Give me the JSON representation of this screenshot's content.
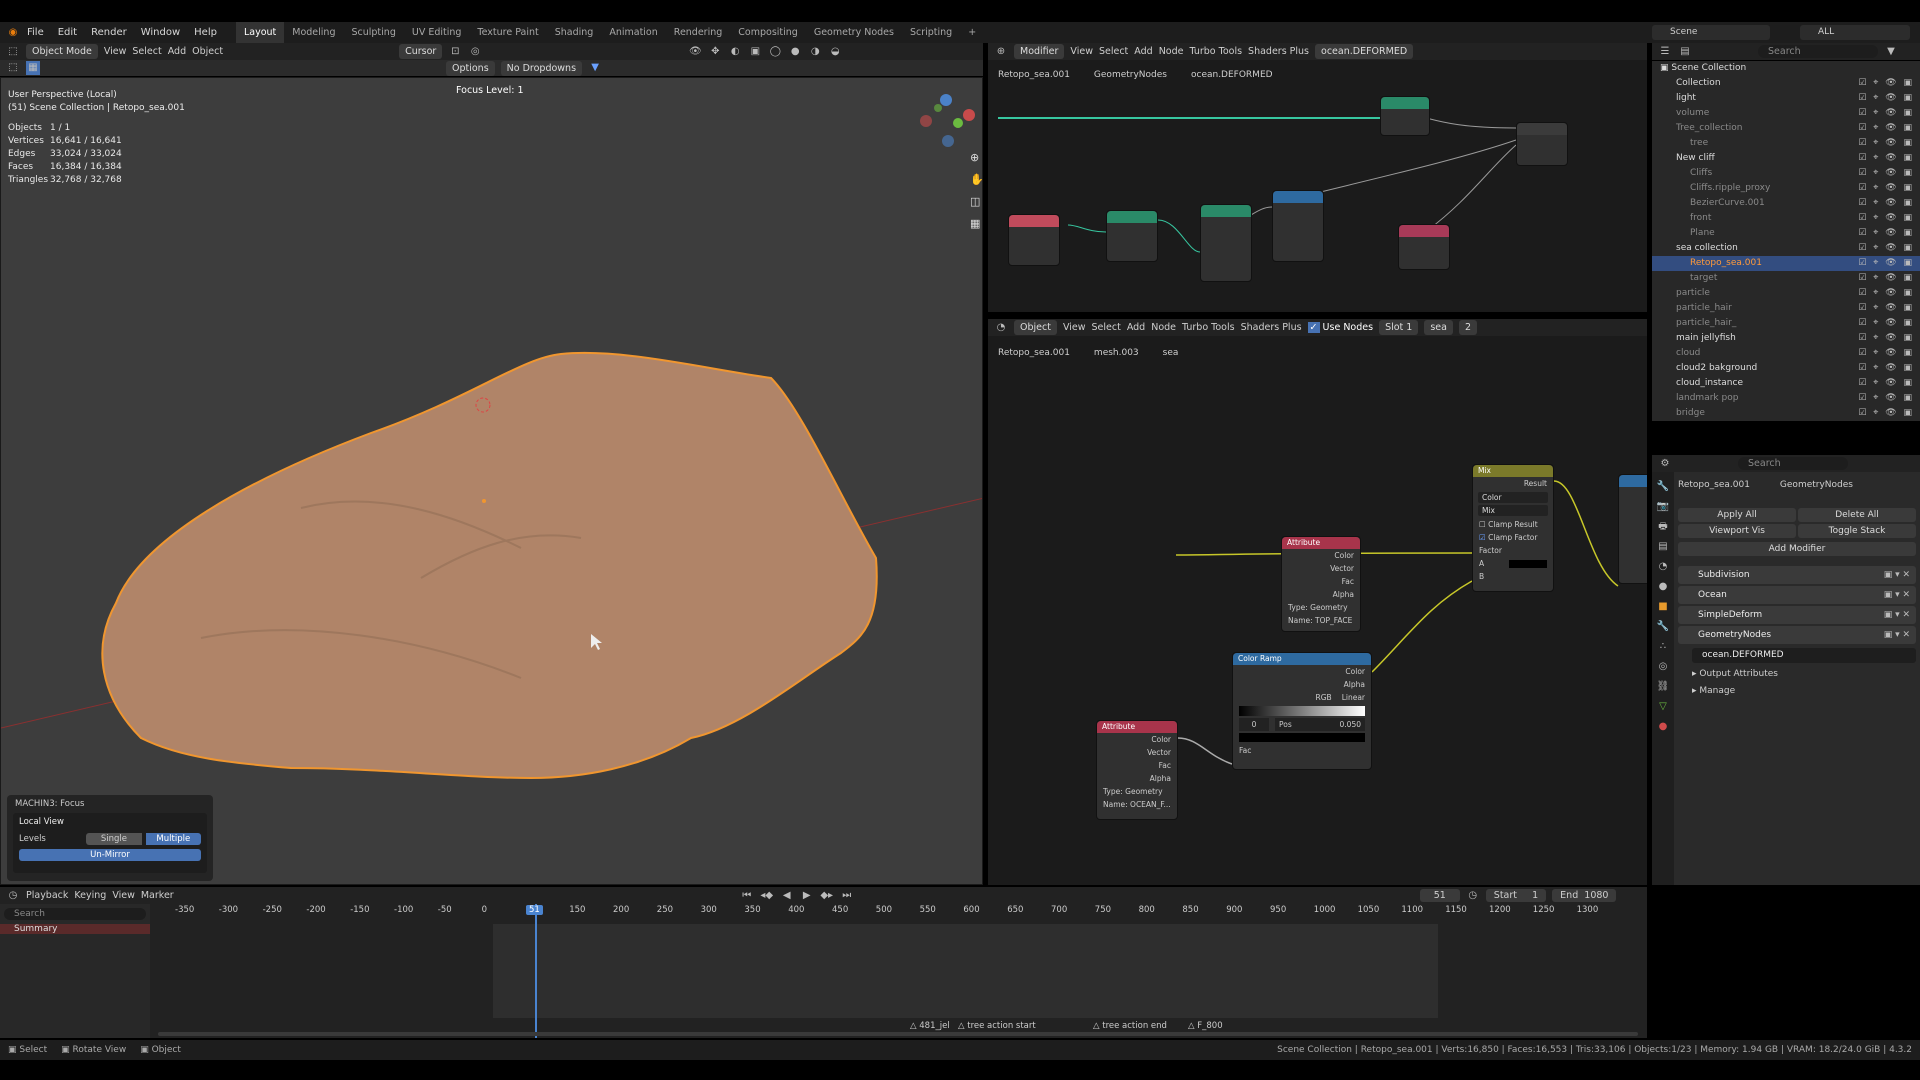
{
  "menu": {
    "items": [
      "File",
      "Edit",
      "Render",
      "Window",
      "Help"
    ]
  },
  "workspaces": [
    "Layout",
    "Modeling",
    "Sculpting",
    "UV Editing",
    "Texture Paint",
    "Shading",
    "Animation",
    "Rendering",
    "Compositing",
    "Geometry Nodes",
    "Scripting",
    "+"
  ],
  "viewport": {
    "mode": "Object Mode",
    "menus": [
      "View",
      "Select",
      "Add",
      "Object"
    ],
    "transform": "Cursor",
    "options": "Options",
    "dropdowns": "No Dropdowns",
    "title": "User Perspective (Local)",
    "subtitle": "(51) Scene Collection | Retopo_sea.001",
    "focus": "Focus Level: 1",
    "stats": [
      [
        "Objects",
        "1 / 1"
      ],
      [
        "Vertices",
        "16,641 / 16,641"
      ],
      [
        "Edges",
        "33,024 / 33,024"
      ],
      [
        "Faces",
        "16,384 / 16,384"
      ],
      [
        "Triangles",
        "32,768 / 32,768"
      ]
    ],
    "panel": {
      "title": "MACHIN3: Focus",
      "local": "Local View",
      "levels": "Levels",
      "single": "Single",
      "multiple": "Multiple",
      "unmirror": "Un-Mirror"
    }
  },
  "geo_editor": {
    "type": "Modifier",
    "menus": [
      "View",
      "Select",
      "Add",
      "Node",
      "Turbo Tools",
      "Shaders Plus"
    ],
    "tree": "ocean.DEFORMED",
    "crumbs": [
      "Retopo_sea.001",
      "GeometryNodes",
      "ocean.DEFORMED"
    ]
  },
  "shader_editor": {
    "type": "Object",
    "menus": [
      "View",
      "Select",
      "Add",
      "Node",
      "Turbo Tools",
      "Shaders Plus"
    ],
    "use_nodes": "Use Nodes",
    "slot": "Slot 1",
    "material": "sea",
    "users": "2",
    "crumbs": [
      "Retopo_sea.001",
      "mesh.003",
      "sea"
    ],
    "nodes": {
      "mix": {
        "title": "Mix",
        "result": "Result",
        "type": "Color",
        "blend": "Mix",
        "clamp_result": "Clamp Result",
        "clamp_factor": "Clamp Factor",
        "factor": "Factor",
        "a": "A",
        "b": "B"
      },
      "attr1": {
        "title": "Attribute",
        "outs": [
          "Color",
          "Vector",
          "Fac",
          "Alpha"
        ],
        "type_label": "Type:",
        "type": "Geometry",
        "name_label": "Name:",
        "name": "TOP_FACE"
      },
      "ramp": {
        "title": "Color Ramp",
        "outs": [
          "Color",
          "Alpha"
        ],
        "mode": "RGB",
        "interp": "Linear",
        "idx": "0",
        "pos_label": "Pos",
        "pos": "0.050",
        "fac": "Fac"
      },
      "attr2": {
        "title": "Attribute",
        "outs": [
          "Color",
          "Vector",
          "Fac",
          "Alpha"
        ],
        "type_label": "Type:",
        "type": "Geometry",
        "name_label": "Name:",
        "name": "OCEAN_F..."
      }
    }
  },
  "outliner": {
    "scene": "Scene",
    "viewlayer": "ALL",
    "search": "Search",
    "root": "Scene Collection",
    "items": [
      {
        "n": "Collection",
        "d": 1
      },
      {
        "n": "light",
        "d": 1
      },
      {
        "n": "volume",
        "d": 1
      },
      {
        "n": "Tree_collection",
        "d": 1
      },
      {
        "n": "tree",
        "d": 2
      },
      {
        "n": "New cliff",
        "d": 1
      },
      {
        "n": "Cliffs",
        "d": 2
      },
      {
        "n": "Cliffs.ripple_proxy",
        "d": 2
      },
      {
        "n": "BezierCurve.001",
        "d": 2
      },
      {
        "n": "front",
        "d": 2
      },
      {
        "n": "Plane",
        "d": 2
      },
      {
        "n": "sea collection",
        "d": 1
      },
      {
        "n": "Retopo_sea.001",
        "d": 2
      },
      {
        "n": "target",
        "d": 2
      },
      {
        "n": "particle",
        "d": 1
      },
      {
        "n": "particle_hair",
        "d": 1
      },
      {
        "n": "particle_hair_",
        "d": 1
      },
      {
        "n": "main jellyfish",
        "d": 1
      },
      {
        "n": "cloud",
        "d": 1
      },
      {
        "n": "cloud2 bakground",
        "d": 1
      },
      {
        "n": "cloud_instance",
        "d": 1
      },
      {
        "n": "landmark pop",
        "d": 1
      },
      {
        "n": "bridge",
        "d": 1
      }
    ]
  },
  "properties": {
    "search": "Search",
    "crumbs": [
      "Retopo_sea.001",
      "GeometryNodes"
    ],
    "apply_all": "Apply All",
    "delete_all": "Delete All",
    "viewport_vis": "Viewport Vis",
    "toggle_stack": "Toggle Stack",
    "add_modifier": "Add Modifier",
    "modifiers": [
      "Subdivision",
      "Ocean",
      "SimpleDeform",
      "GeometryNodes"
    ],
    "node_group": "ocean.DEFORMED",
    "output_attrs": "Output Attributes",
    "manage": "Manage"
  },
  "timeline": {
    "menus": [
      "Playback",
      "Keying",
      "View",
      "Marker"
    ],
    "current": "51",
    "start_label": "Start",
    "start": "1",
    "end_label": "End",
    "end": "1080",
    "search": "Search",
    "summary": "Summary",
    "ticks": [
      "-350",
      "-300",
      "-250",
      "-200",
      "-150",
      "-100",
      "-50",
      "0",
      "51",
      "100",
      "150",
      "200",
      "250",
      "300",
      "350",
      "400",
      "450",
      "500",
      "550",
      "600",
      "650",
      "700",
      "750",
      "800",
      "850",
      "900",
      "950",
      "1000",
      "1050",
      "1100",
      "1150",
      "1200",
      "1250",
      "1300"
    ],
    "markers": [
      "481_jel",
      "tree action start",
      "tree action end",
      "F_800"
    ]
  },
  "status": {
    "left": [
      "Select",
      "Rotate View",
      "Object"
    ],
    "right": "Scene Collection | Retopo_sea.001 | Verts:16,850 | Faces:16,553 | Tris:33,106 | Objects:1/23 | Memory: 1.94 GB | VRAM: 18.2/24.0 GiB | 4.3.2"
  }
}
